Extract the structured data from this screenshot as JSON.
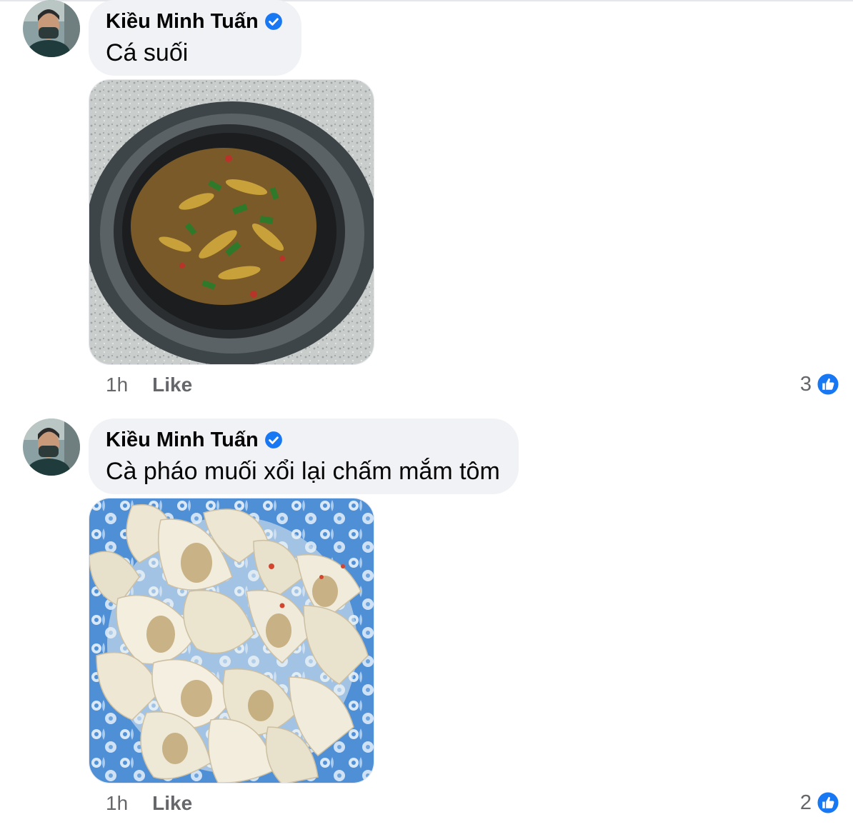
{
  "comments": [
    {
      "author": "Kiều Minh Tuấn",
      "verified_icon": "verified-badge-icon",
      "text": "Cá suối",
      "photo": "photo-stewed-stream-fish-in-clay-pot",
      "time": "1h",
      "like_label": "Like",
      "reaction_count": "3",
      "reaction_icon": "like-reaction-icon"
    },
    {
      "author": "Kiều Minh Tuấn",
      "verified_icon": "verified-badge-icon",
      "text": "Cà pháo muối xổi lại chấm mắm tôm",
      "photo": "photo-pickled-eggplant-on-blue-plate",
      "time": "1h",
      "like_label": "Like",
      "reaction_count": "2",
      "reaction_icon": "like-reaction-icon"
    }
  ],
  "colors": {
    "bubble_bg": "#f0f2f5",
    "accent_blue": "#1877f2",
    "meta_gray": "#65676b",
    "text": "#050505"
  }
}
